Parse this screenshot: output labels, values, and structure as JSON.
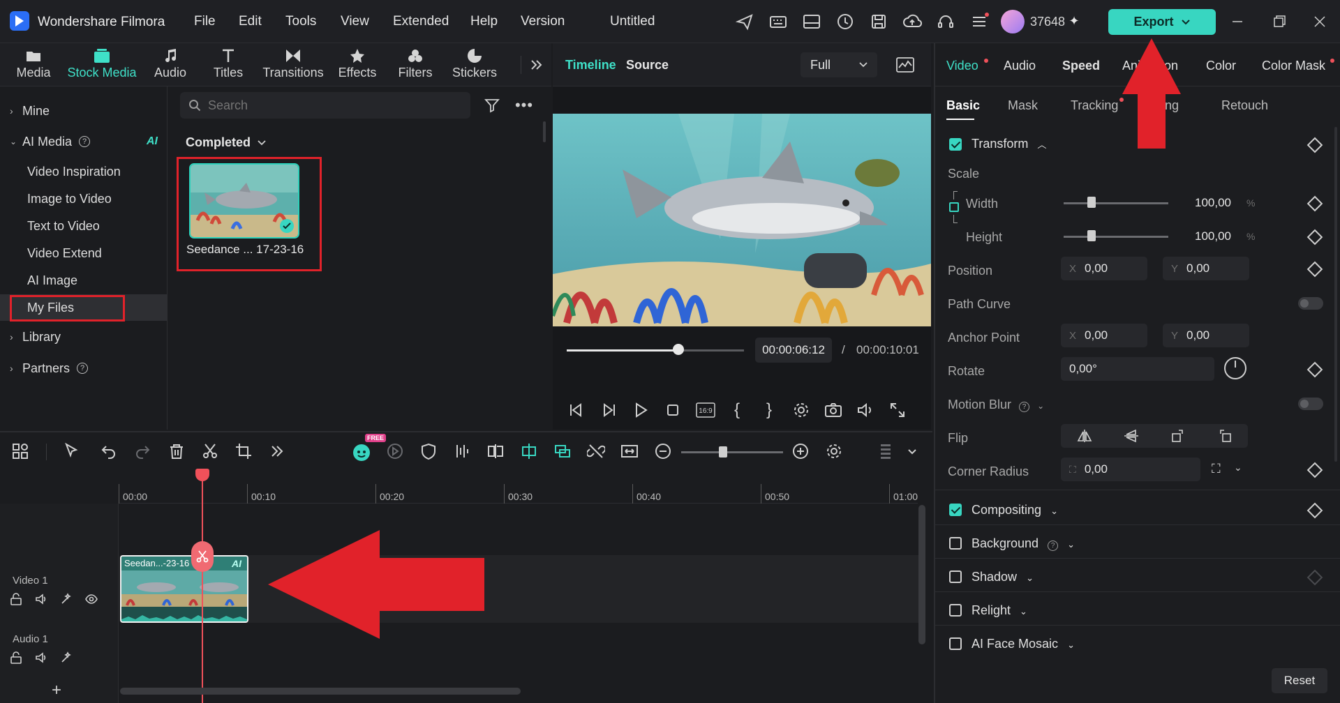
{
  "app": {
    "title": "Wondershare Filmora",
    "document": "Untitled"
  },
  "menu": [
    "File",
    "Edit",
    "Tools",
    "View",
    "Extended",
    "Help",
    "Version"
  ],
  "account": {
    "credits": "37648"
  },
  "export": {
    "label": "Export"
  },
  "media_tabs": [
    {
      "label": "Media",
      "icon": "media-folder-icon"
    },
    {
      "label": "Stock Media",
      "icon": "stock-media-icon",
      "active": true
    },
    {
      "label": "Audio",
      "icon": "music-note-icon"
    },
    {
      "label": "Titles",
      "icon": "text-t-icon"
    },
    {
      "label": "Transitions",
      "icon": "transition-icon"
    },
    {
      "label": "Effects",
      "icon": "effects-icon"
    },
    {
      "label": "Filters",
      "icon": "filters-icon"
    },
    {
      "label": "Stickers",
      "icon": "stickers-icon"
    }
  ],
  "left_nav": {
    "mine": "Mine",
    "ai_media": "AI Media",
    "ai_badge": "AI",
    "items": [
      "Video Inspiration",
      "Image to Video",
      "Text to Video",
      "Video Extend",
      "AI Image",
      "My Files"
    ],
    "library": "Library",
    "partners": "Partners"
  },
  "search": {
    "placeholder": "Search"
  },
  "media_grid": {
    "filter_label": "Completed",
    "items": [
      {
        "caption": "Seedance ... 17-23-16"
      }
    ]
  },
  "preview": {
    "tab_timeline": "Timeline",
    "tab_source": "Source",
    "zoom": "Full",
    "current_time": "00:00:06:12",
    "separator": "/",
    "total_time": "00:00:10:01",
    "progress": 0.63,
    "aspect": "16:9"
  },
  "props": {
    "tabs": [
      "Video",
      "Audio",
      "Speed",
      "Animation",
      "Color",
      "Color Mask"
    ],
    "subtabs": [
      "Basic",
      "Mask",
      "Tracking",
      "Matting",
      "Retouch"
    ],
    "transform": "Transform",
    "scale": "Scale",
    "width_label": "Width",
    "height_label": "Height",
    "width_value": "100,00",
    "height_value": "100,00",
    "percent": "%",
    "position": "Position",
    "pos_x": "0,00",
    "pos_y": "0,00",
    "path_curve": "Path Curve",
    "anchor_point": "Anchor Point",
    "anchor_x": "0,00",
    "anchor_y": "0,00",
    "rotate": "Rotate",
    "rotate_value": "0,00°",
    "motion_blur": "Motion Blur",
    "flip": "Flip",
    "corner_radius": "Corner Radius",
    "corner_value": "0,00",
    "axis_x": "X",
    "axis_y": "Y",
    "compositing": "Compositing",
    "background": "Background",
    "shadow": "Shadow",
    "relight": "Relight",
    "ai_face_mosaic": "AI Face Mosaic",
    "reset": "Reset"
  },
  "timeline": {
    "ruler": [
      "00:00",
      "00:10",
      "00:20",
      "00:30",
      "00:40",
      "00:50",
      "01:00"
    ],
    "tracks": [
      {
        "name": "Video 1"
      },
      {
        "name": "Audio 1"
      }
    ],
    "clip": {
      "label": "Seedan...-23-16",
      "badge": "AI"
    },
    "free_badge": "FREE"
  },
  "colors": {
    "accent": "#38d6c1",
    "annotation": "#e1222a",
    "playhead": "#f0515a"
  }
}
